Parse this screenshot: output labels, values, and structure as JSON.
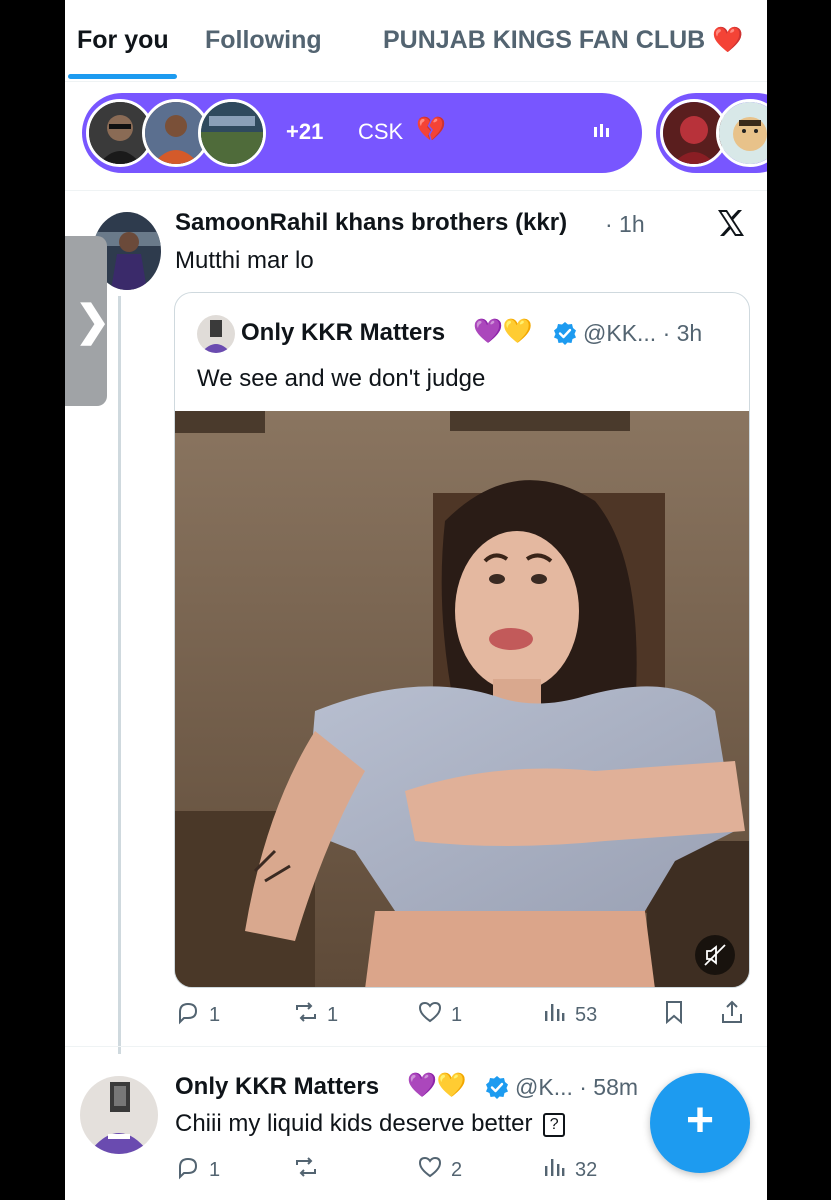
{
  "tabs": {
    "for_you": "For you",
    "following": "Following",
    "club": "PUNJAB KINGS FAN CLUB",
    "club_emoji": "❤️"
  },
  "spaces": {
    "count_label": "+21",
    "name": "CSK",
    "name_emoji": "💔",
    "listen_icon": "audio-bars-icon",
    "accent_color": "#7856ff"
  },
  "side_handle": {
    "glyph": "❯"
  },
  "tweet1": {
    "author": "SamoonRahil khans brothers (kkr)",
    "time": "· 1h",
    "text": "Mutthi mar lo",
    "quote": {
      "author": "Only KKR Matters",
      "emojis": "💜💛",
      "handle": "@KK... · 3h",
      "text": "We see and we don't judge",
      "media_icon": "muted-speaker-icon"
    },
    "actions": {
      "replies": "1",
      "reposts": "1",
      "likes": "1",
      "views": "53"
    }
  },
  "tweet2": {
    "author": "Only KKR Matters",
    "emojis": "💜💛",
    "handle": "@K... · 58m",
    "text": "Chiii my liquid kids deserve better",
    "unknown_glyph": "?",
    "actions": {
      "replies": "1",
      "reposts": "",
      "likes": "2",
      "views": "32"
    }
  },
  "fab": {
    "label": "+"
  },
  "colors": {
    "accent": "#1d9bf0",
    "secondary_text": "#536471",
    "verified": "#1d9bf0"
  }
}
